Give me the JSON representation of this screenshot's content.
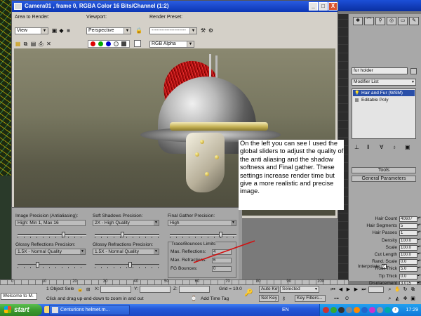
{
  "render_window": {
    "title": "Camera01 , frame 0, RGBA Color 16 Bits/Channel (1:2)",
    "area_to_render_label": "Area to Render:",
    "area_to_render_value": "View",
    "viewport_label": "Viewport:",
    "viewport_value": "Perspective",
    "render_preset_label": "Render Preset:",
    "render_preset_value": "---------------------",
    "channel_value": "RGB Alpha",
    "controls": {
      "minimize": "_",
      "maximize": "□",
      "close": "X"
    }
  },
  "note": {
    "text": "On the left you can see I used the global sliders to adjust the quality of the anti aliasing and the shadow softness and Final gather. These settings increase render time but give a more realistic and precise image."
  },
  "render_settings": {
    "image_precision_label": "Image Precision (Antialiasing):",
    "image_precision_value": "High: Min 1, Max 16",
    "image_precision_level": 0.68,
    "soft_shadows_label": "Soft Shadows Precision:",
    "soft_shadows_value": "2X - High Quality",
    "soft_shadows_level": 0.42,
    "final_gather_label": "Final Gather Precision:",
    "final_gather_value": "High",
    "final_gather_level": 0.78,
    "glossy_reflections_label": "Glossy Reflections Precision:",
    "glossy_reflections_value": "1.5X - Normal Quality",
    "glossy_reflections_level": 0.28,
    "glossy_refractions_label": "Glossy Refractions Precision:",
    "glossy_refractions_value": "1.5X - Normal Quality",
    "glossy_refractions_level": 0.55,
    "trace_label": "Trace/Bounces Limits",
    "max_reflections_label": "Max. Reflections:",
    "max_reflections_value": "4",
    "max_refractions_label": "Max. Refractions:",
    "max_refractions_value": "6",
    "fg_bounces_label": "FG Bounces:",
    "fg_bounces_value": "0"
  },
  "command_panel": {
    "object_name": "fur holder",
    "modifier_list": "Modifier List",
    "stack": [
      "Hair and Fur (WSM)",
      "Editable Poly"
    ],
    "tools_rollout": "Tools",
    "general_rollout": "General Parameters",
    "params": [
      {
        "label": "Hair Count",
        "value": "40607"
      },
      {
        "label": "Hair Segments",
        "value": "5"
      },
      {
        "label": "Hair Passes",
        "value": "1"
      },
      {
        "label": "Density",
        "value": "100.0"
      },
      {
        "label": "Scale",
        "value": "100.0"
      },
      {
        "label": "Cut Length",
        "value": "100.0"
      },
      {
        "label": "Rand. Scale",
        "value": "0.0"
      },
      {
        "label": "Root Thick",
        "value": "5.0"
      },
      {
        "label": "Tip Thick",
        "value": "0.0"
      },
      {
        "label": "Displacement",
        "value": "3.015"
      }
    ],
    "interpolate_label": "Interpolate"
  },
  "timeline": {
    "ticks": [
      "0",
      "10",
      "20",
      "30",
      "40",
      "50",
      "60",
      "70",
      "80",
      "90",
      "100"
    ]
  },
  "status_bar": {
    "welcome": "Welcome to M.",
    "selection": "1 Object Sele",
    "x_label": "X:",
    "y_label": "Y:",
    "z_label": "Z:",
    "grid": "Grid = 10.0",
    "prompt": "Click and drag up-and-down to zoom in and out",
    "add_time_tag": "Add Time Tag",
    "auto_key": "Auto Key",
    "set_key": "Set Key",
    "selected": "Selected",
    "key_filters": "Key Filters..."
  },
  "taskbar": {
    "start": "start",
    "task_label": "Centurions helmet.m...",
    "language": "EN",
    "clock": "17:29"
  }
}
